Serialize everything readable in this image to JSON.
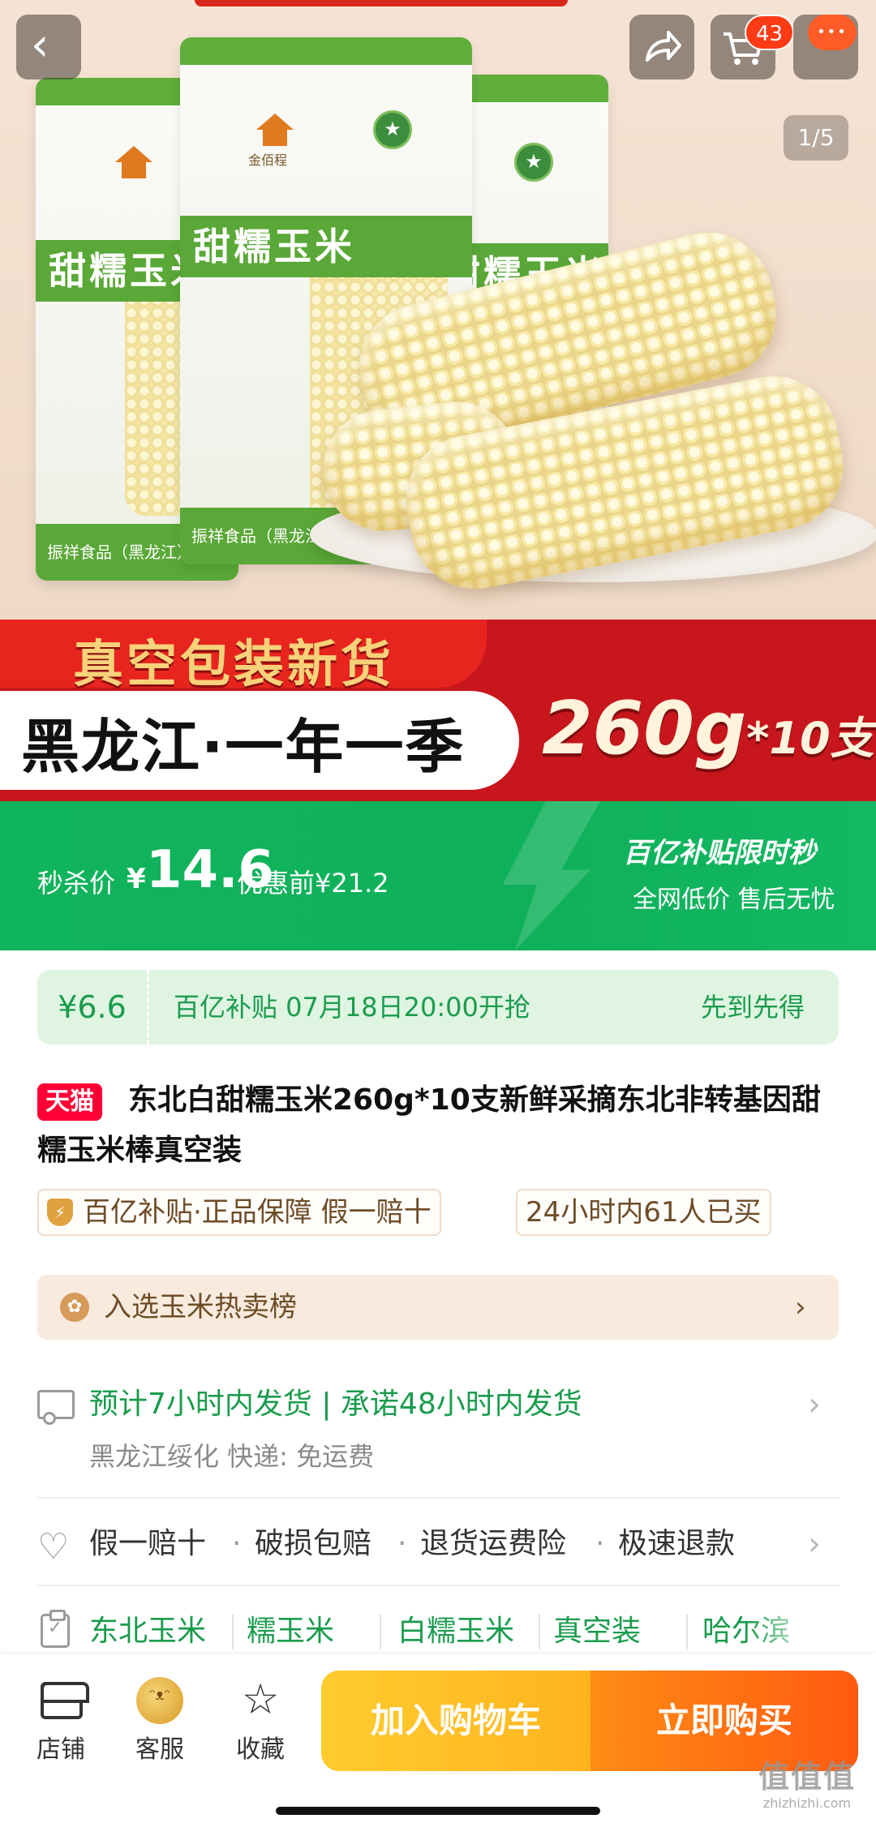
{
  "hero": {
    "page_indicator": "1/5",
    "cart_count": "43",
    "package_title": "甜糯玉米",
    "package_brand": "金佰程",
    "package_footer": "振祥食品（黑龙江）",
    "slogan_top": "真空包装新货",
    "slogan_main": "黑龙江·一年一季",
    "weight_main": "260g",
    "weight_suffix": "*10支"
  },
  "price_banner": {
    "label": "秒杀价",
    "currency": "¥",
    "price": "14.6",
    "original": "优惠前¥21.2",
    "subsidy_title": "百亿补贴限时秒",
    "tagline": "全网低价 售后无忧"
  },
  "subsidy_strip": {
    "price": "¥6.6",
    "text": "百亿补贴 07月18日20:00开抢",
    "right": "先到先得"
  },
  "product": {
    "badge": "天猫",
    "title": "东北白甜糯玉米260g*10支新鲜采摘东北非转基因甜糯玉米棒真空装",
    "tags": [
      "百亿补贴·正品保障 假一赔十",
      "24小时内61人已买"
    ]
  },
  "rank": {
    "text": "入选玉米热卖榜"
  },
  "shipping": {
    "main": "预计7小时内发货 | 承诺48小时内发货",
    "sub": "黑龙江绥化 快递: 免运费"
  },
  "services": [
    "假一赔十",
    "破损包赔",
    "退货运费险",
    "极速退款"
  ],
  "keywords": [
    "东北玉米",
    "糯玉米",
    "白糯玉米",
    "真空装",
    "哈尔滨"
  ],
  "bottom_bar": {
    "store": "店铺",
    "service": "客服",
    "favorite": "收藏",
    "add_to_cart": "加入购物车",
    "buy_now": "立即购买"
  },
  "watermark": {
    "big": "值值值",
    "small": "zhizhizhi.com"
  },
  "colors": {
    "accent_green": "#1a9c4d",
    "banner_green": "#10b45c",
    "banner_red": "#c8161d",
    "tmall_red": "#ff0036",
    "cart_yellow": "#ffb41f",
    "buy_orange": "#ff5a10"
  },
  "icons": [
    "back-icon",
    "share-icon",
    "cart-icon",
    "more-icon",
    "award-icon",
    "chevron-right-icon",
    "truck-icon",
    "heart-icon",
    "clipboard-icon",
    "store-icon",
    "service-icon",
    "star-icon"
  ]
}
